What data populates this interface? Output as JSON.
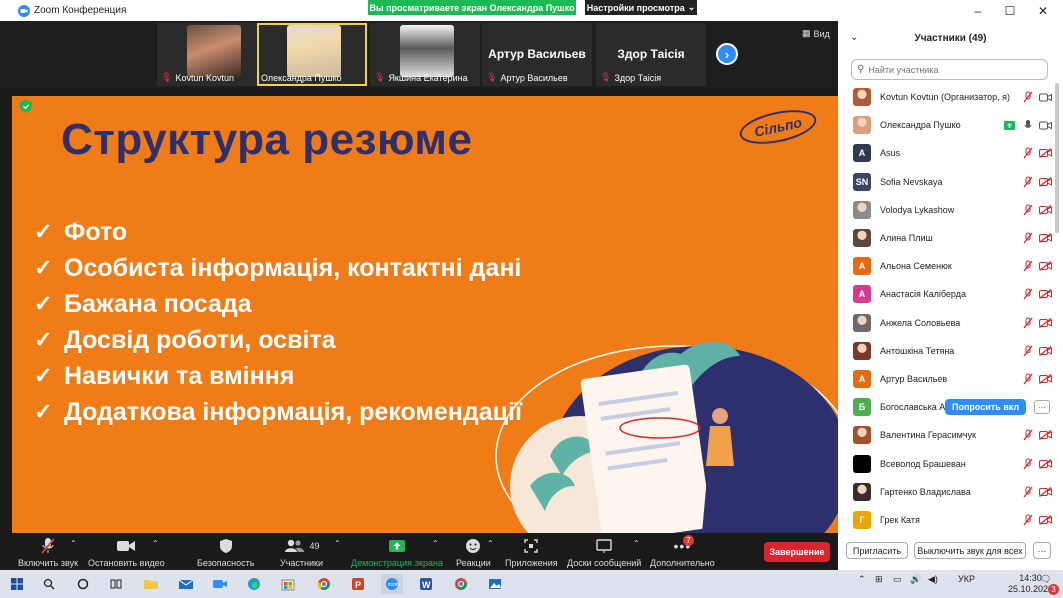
{
  "window": {
    "title": "Zoom Конференция",
    "share_banner": "Вы просматриваете экран Олександра Пушко",
    "view_settings": "Настройки просмотра",
    "minimize": "–",
    "maximize": "☐",
    "close": "✕"
  },
  "strip": {
    "thumbnails": [
      {
        "name": "Kovtun Kovtun",
        "type": "video"
      },
      {
        "name": "Олександра Пушко",
        "type": "video"
      },
      {
        "name": "Якшина Екатерина",
        "type": "video"
      },
      {
        "name": "Артур Васильев",
        "big": "Артур Васильев",
        "type": "name"
      },
      {
        "name": "Здор Таісія",
        "big": "Здор Таісія",
        "type": "name"
      }
    ],
    "view_label": "Вид"
  },
  "slide": {
    "title": "Структура резюме",
    "brand": "Сільпо",
    "bullets": [
      "Фото",
      "Особиста інформація, контактні дані",
      "Бажана посада",
      "Досвід роботи, освіта",
      "Навички та вміння",
      "Додаткова інформація, рекомендації"
    ],
    "colors": {
      "background": "#f07c18",
      "title": "#2d2f6e"
    }
  },
  "toolbar": {
    "unmute": "Включить звук",
    "stop_video": "Остановить видео",
    "security": "Безопасность",
    "participants": "Участники",
    "participants_count": "49",
    "share_screen": "Демонстрация экрана",
    "reactions": "Реакции",
    "apps": "Приложения",
    "whiteboards": "Доски сообщений",
    "more": "Дополнительно",
    "more_badge": "7",
    "end": "Завершение"
  },
  "panel": {
    "title": "Участники (49)",
    "search_placeholder": "Найти участника",
    "ask_unmute": "Попросить вкл",
    "invite": "Пригласить",
    "mute_all": "Выключить звук для всех",
    "more": "···",
    "participants": [
      {
        "name": "Kovtun Kovtun (Организатор, я)",
        "avatar": "photo",
        "color": "#b05a3a",
        "initial": ""
      },
      {
        "name": "Олександра Пушко",
        "avatar": "photo",
        "color": "#d9a079",
        "initial": ""
      },
      {
        "name": "Asus",
        "avatar": "letter",
        "color": "#2d3a55",
        "initial": "A"
      },
      {
        "name": "Sofia Nevskaya",
        "avatar": "letter",
        "color": "#3a4660",
        "initial": "SN"
      },
      {
        "name": "Volodya Lykashow",
        "avatar": "photo",
        "color": "#8c8c8c",
        "initial": ""
      },
      {
        "name": "Алина Плиш",
        "avatar": "photo",
        "color": "#5c4a3c",
        "initial": ""
      },
      {
        "name": "Альона Семенюк",
        "avatar": "letter",
        "color": "#e56a12",
        "initial": "А"
      },
      {
        "name": "Анастасія Калiберда",
        "avatar": "letter",
        "color": "#d63b8f",
        "initial": "А"
      },
      {
        "name": "Анжела Соловьева",
        "avatar": "photo",
        "color": "#6b6b6b",
        "initial": ""
      },
      {
        "name": "Антошкіна Тетяна",
        "avatar": "photo",
        "color": "#7a3a2a",
        "initial": ""
      },
      {
        "name": "Артур Васильев",
        "avatar": "letter",
        "color": "#e56a12",
        "initial": "А"
      },
      {
        "name": "Богославська А",
        "avatar": "letter",
        "color": "#4caf50",
        "initial": "Б"
      },
      {
        "name": "Валентина Герасимчук",
        "avatar": "photo",
        "color": "#a0522d",
        "initial": ""
      },
      {
        "name": "Всеволод Брашеван",
        "avatar": "letter",
        "color": "#000000",
        "initial": ""
      },
      {
        "name": "Гартенко Владислава",
        "avatar": "photo",
        "color": "#3d2b2b",
        "initial": ""
      },
      {
        "name": "Грек Катя",
        "avatar": "letter",
        "color": "#f0a400",
        "initial": "Г"
      }
    ]
  },
  "taskbar": {
    "lang": "УКР",
    "time": "14:30",
    "date": "25.10.2022",
    "notifications": "3"
  }
}
